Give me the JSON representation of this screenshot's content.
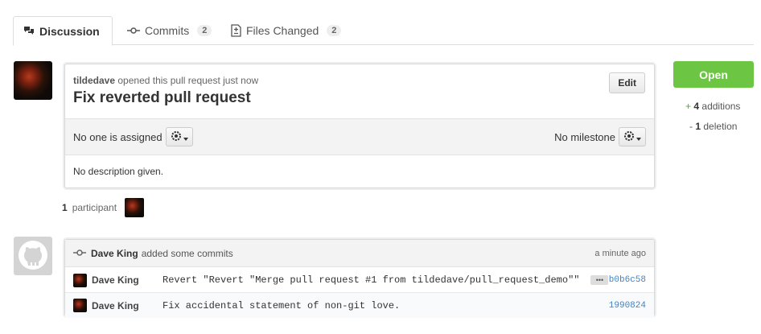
{
  "tabs": [
    {
      "label": "Discussion",
      "icon": "discussion-icon"
    },
    {
      "label": "Commits",
      "count": "2",
      "icon": "commit-icon"
    },
    {
      "label": "Files Changed",
      "count": "2",
      "icon": "file-diff-icon"
    }
  ],
  "pr": {
    "author": "tildedave",
    "meta_text": "opened this pull request just now",
    "title": "Fix reverted pull request",
    "edit_label": "Edit",
    "assignee_text": "No one is assigned",
    "milestone_text": "No milestone",
    "description": "No description given."
  },
  "participants": {
    "count": "1",
    "label": "participant"
  },
  "sidebar": {
    "state_label": "Open",
    "additions_count": "4",
    "additions_label": "additions",
    "deletions_count": "1",
    "deletions_label": "deletion",
    "colors": {
      "open": "#6cc644",
      "additions": "#55a532"
    }
  },
  "commits": {
    "author": "Dave King",
    "action_text": "added some commits",
    "when": "a minute ago",
    "rows": [
      {
        "author": "Dave King",
        "message": "Revert \"Revert \"Merge pull request #1 from tildedave/pull_request_demo\"\"",
        "sha": "b0b6c58",
        "has_ellipsis": true
      },
      {
        "author": "Dave King",
        "message": "Fix accidental statement of non-git love.",
        "sha": "1990824"
      }
    ]
  }
}
